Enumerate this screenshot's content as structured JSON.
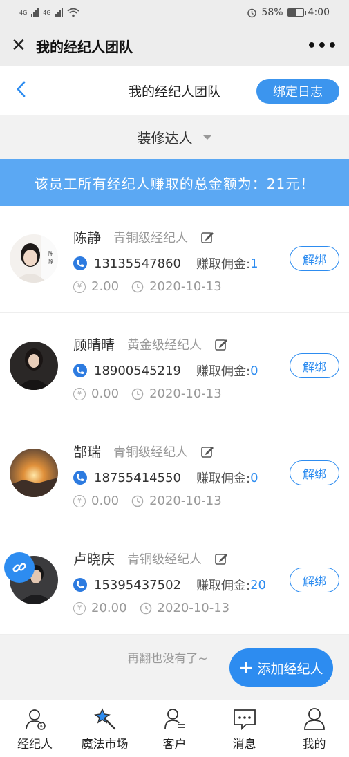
{
  "status": {
    "net1": "4G",
    "net2": "4G",
    "battery_text": "58%",
    "battery_level": 0.58,
    "time": "4:00"
  },
  "wechat": {
    "title": "我的经纪人团队"
  },
  "nav": {
    "title": "我的经纪人团队",
    "bind_log": "绑定日志"
  },
  "selector": {
    "value": "装修达人"
  },
  "banner": {
    "text": "该员工所有经纪人赚取的总金额为：21元！"
  },
  "labels": {
    "earn": "赚取佣金:",
    "unbind": "解绑",
    "yen": "¥"
  },
  "agents": [
    {
      "name": "陈静",
      "level": "青铜级经纪人",
      "phone": "13135547860",
      "commission": "1",
      "amount": "2.00",
      "date": "2020-10-13"
    },
    {
      "name": "顾晴晴",
      "level": "黄金级经纪人",
      "phone": "18900545219",
      "commission": "0",
      "amount": "0.00",
      "date": "2020-10-13"
    },
    {
      "name": "郜瑞",
      "level": "青铜级经纪人",
      "phone": "18755414550",
      "commission": "0",
      "amount": "0.00",
      "date": "2020-10-13"
    },
    {
      "name": "卢晓庆",
      "level": "青铜级经纪人",
      "phone": "15395437502",
      "commission": "20",
      "amount": "20.00",
      "date": "2020-10-13"
    }
  ],
  "footer": {
    "no_more": "再翻也没有了~",
    "add_agent": "添加经纪人"
  },
  "tabs": [
    "经纪人",
    "魔法市场",
    "客户",
    "消息",
    "我的"
  ],
  "colors": {
    "accent": "#2d8cf0",
    "banner": "#5ba8f3"
  }
}
